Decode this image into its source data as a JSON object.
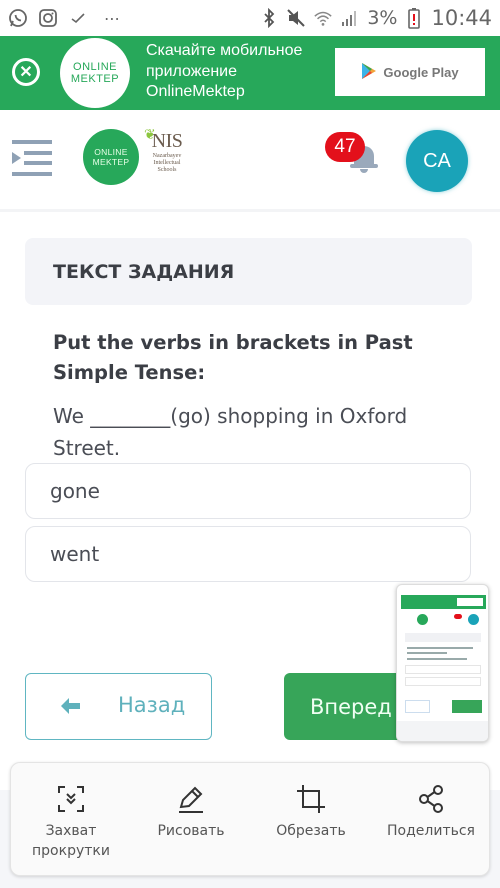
{
  "status_bar": {
    "left_icons": [
      "whatsapp-icon",
      "instagram-icon",
      "check-icon",
      "more-icon"
    ],
    "right_icons": [
      "bluetooth-icon",
      "mute-icon",
      "wifi-icon",
      "signal-icon"
    ],
    "battery_percent": "3%",
    "time": "10:44"
  },
  "app_banner": {
    "logo_line1": "ONLINE",
    "logo_line2": "MEKTEP",
    "text_line1": "Скачайте мобильное",
    "text_line2": "приложение",
    "text_line3": "OnlineMektep",
    "store_button": "Google Play",
    "brand_color": "#27a85a"
  },
  "header": {
    "logo_line1": "ONLINE",
    "logo_line2": "MEKTEP",
    "partner_title": "NIS",
    "partner_sub1": "Nazarbayev",
    "partner_sub2": "Intellectual",
    "partner_sub3": "Schools",
    "notifications_count": "47",
    "avatar_initials": "CA"
  },
  "task": {
    "section_title": "ТЕКСТ ЗАДАНИЯ",
    "prompt": "Put the verbs in brackets in Past Simple Tense:",
    "sentence": "We ________(go) shopping in Oxford Street.",
    "options": [
      {
        "label": "gone"
      },
      {
        "label": "went"
      }
    ]
  },
  "navigation": {
    "back_label": "Назад",
    "next_label": "Вперед"
  },
  "screenshot_toolbar": {
    "tools": [
      {
        "icon": "scroll-capture-icon",
        "label_line1": "Захват",
        "label_line2": "прокрутки"
      },
      {
        "icon": "draw-icon",
        "label_line1": "Рисовать",
        "label_line2": ""
      },
      {
        "icon": "crop-icon",
        "label_line1": "Обрезать",
        "label_line2": ""
      },
      {
        "icon": "share-icon",
        "label_line1": "Поделиться",
        "label_line2": ""
      }
    ]
  }
}
